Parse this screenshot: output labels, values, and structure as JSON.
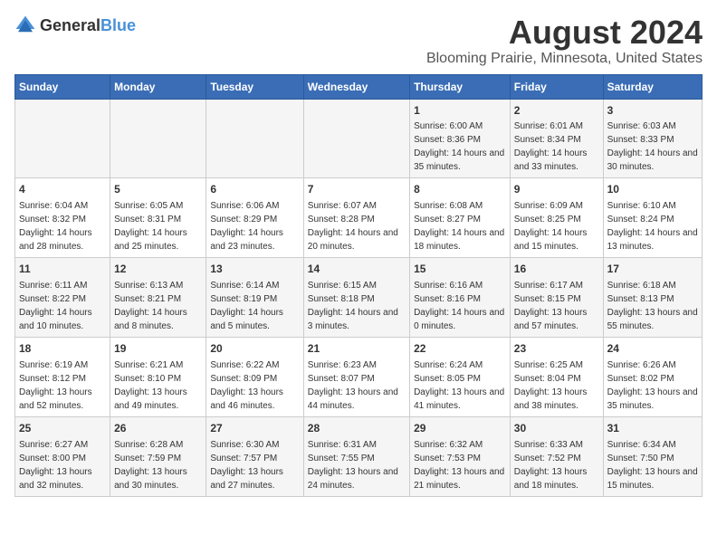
{
  "header": {
    "logo_general": "General",
    "logo_blue": "Blue",
    "main_title": "August 2024",
    "subtitle": "Blooming Prairie, Minnesota, United States"
  },
  "days_of_week": [
    "Sunday",
    "Monday",
    "Tuesday",
    "Wednesday",
    "Thursday",
    "Friday",
    "Saturday"
  ],
  "weeks": [
    {
      "cells": [
        {
          "day": "",
          "sunrise": "",
          "sunset": "",
          "daylight": ""
        },
        {
          "day": "",
          "sunrise": "",
          "sunset": "",
          "daylight": ""
        },
        {
          "day": "",
          "sunrise": "",
          "sunset": "",
          "daylight": ""
        },
        {
          "day": "",
          "sunrise": "",
          "sunset": "",
          "daylight": ""
        },
        {
          "day": "1",
          "sunrise": "Sunrise: 6:00 AM",
          "sunset": "Sunset: 8:36 PM",
          "daylight": "Daylight: 14 hours and 35 minutes."
        },
        {
          "day": "2",
          "sunrise": "Sunrise: 6:01 AM",
          "sunset": "Sunset: 8:34 PM",
          "daylight": "Daylight: 14 hours and 33 minutes."
        },
        {
          "day": "3",
          "sunrise": "Sunrise: 6:03 AM",
          "sunset": "Sunset: 8:33 PM",
          "daylight": "Daylight: 14 hours and 30 minutes."
        }
      ]
    },
    {
      "cells": [
        {
          "day": "4",
          "sunrise": "Sunrise: 6:04 AM",
          "sunset": "Sunset: 8:32 PM",
          "daylight": "Daylight: 14 hours and 28 minutes."
        },
        {
          "day": "5",
          "sunrise": "Sunrise: 6:05 AM",
          "sunset": "Sunset: 8:31 PM",
          "daylight": "Daylight: 14 hours and 25 minutes."
        },
        {
          "day": "6",
          "sunrise": "Sunrise: 6:06 AM",
          "sunset": "Sunset: 8:29 PM",
          "daylight": "Daylight: 14 hours and 23 minutes."
        },
        {
          "day": "7",
          "sunrise": "Sunrise: 6:07 AM",
          "sunset": "Sunset: 8:28 PM",
          "daylight": "Daylight: 14 hours and 20 minutes."
        },
        {
          "day": "8",
          "sunrise": "Sunrise: 6:08 AM",
          "sunset": "Sunset: 8:27 PM",
          "daylight": "Daylight: 14 hours and 18 minutes."
        },
        {
          "day": "9",
          "sunrise": "Sunrise: 6:09 AM",
          "sunset": "Sunset: 8:25 PM",
          "daylight": "Daylight: 14 hours and 15 minutes."
        },
        {
          "day": "10",
          "sunrise": "Sunrise: 6:10 AM",
          "sunset": "Sunset: 8:24 PM",
          "daylight": "Daylight: 14 hours and 13 minutes."
        }
      ]
    },
    {
      "cells": [
        {
          "day": "11",
          "sunrise": "Sunrise: 6:11 AM",
          "sunset": "Sunset: 8:22 PM",
          "daylight": "Daylight: 14 hours and 10 minutes."
        },
        {
          "day": "12",
          "sunrise": "Sunrise: 6:13 AM",
          "sunset": "Sunset: 8:21 PM",
          "daylight": "Daylight: 14 hours and 8 minutes."
        },
        {
          "day": "13",
          "sunrise": "Sunrise: 6:14 AM",
          "sunset": "Sunset: 8:19 PM",
          "daylight": "Daylight: 14 hours and 5 minutes."
        },
        {
          "day": "14",
          "sunrise": "Sunrise: 6:15 AM",
          "sunset": "Sunset: 8:18 PM",
          "daylight": "Daylight: 14 hours and 3 minutes."
        },
        {
          "day": "15",
          "sunrise": "Sunrise: 6:16 AM",
          "sunset": "Sunset: 8:16 PM",
          "daylight": "Daylight: 14 hours and 0 minutes."
        },
        {
          "day": "16",
          "sunrise": "Sunrise: 6:17 AM",
          "sunset": "Sunset: 8:15 PM",
          "daylight": "Daylight: 13 hours and 57 minutes."
        },
        {
          "day": "17",
          "sunrise": "Sunrise: 6:18 AM",
          "sunset": "Sunset: 8:13 PM",
          "daylight": "Daylight: 13 hours and 55 minutes."
        }
      ]
    },
    {
      "cells": [
        {
          "day": "18",
          "sunrise": "Sunrise: 6:19 AM",
          "sunset": "Sunset: 8:12 PM",
          "daylight": "Daylight: 13 hours and 52 minutes."
        },
        {
          "day": "19",
          "sunrise": "Sunrise: 6:21 AM",
          "sunset": "Sunset: 8:10 PM",
          "daylight": "Daylight: 13 hours and 49 minutes."
        },
        {
          "day": "20",
          "sunrise": "Sunrise: 6:22 AM",
          "sunset": "Sunset: 8:09 PM",
          "daylight": "Daylight: 13 hours and 46 minutes."
        },
        {
          "day": "21",
          "sunrise": "Sunrise: 6:23 AM",
          "sunset": "Sunset: 8:07 PM",
          "daylight": "Daylight: 13 hours and 44 minutes."
        },
        {
          "day": "22",
          "sunrise": "Sunrise: 6:24 AM",
          "sunset": "Sunset: 8:05 PM",
          "daylight": "Daylight: 13 hours and 41 minutes."
        },
        {
          "day": "23",
          "sunrise": "Sunrise: 6:25 AM",
          "sunset": "Sunset: 8:04 PM",
          "daylight": "Daylight: 13 hours and 38 minutes."
        },
        {
          "day": "24",
          "sunrise": "Sunrise: 6:26 AM",
          "sunset": "Sunset: 8:02 PM",
          "daylight": "Daylight: 13 hours and 35 minutes."
        }
      ]
    },
    {
      "cells": [
        {
          "day": "25",
          "sunrise": "Sunrise: 6:27 AM",
          "sunset": "Sunset: 8:00 PM",
          "daylight": "Daylight: 13 hours and 32 minutes."
        },
        {
          "day": "26",
          "sunrise": "Sunrise: 6:28 AM",
          "sunset": "Sunset: 7:59 PM",
          "daylight": "Daylight: 13 hours and 30 minutes."
        },
        {
          "day": "27",
          "sunrise": "Sunrise: 6:30 AM",
          "sunset": "Sunset: 7:57 PM",
          "daylight": "Daylight: 13 hours and 27 minutes."
        },
        {
          "day": "28",
          "sunrise": "Sunrise: 6:31 AM",
          "sunset": "Sunset: 7:55 PM",
          "daylight": "Daylight: 13 hours and 24 minutes."
        },
        {
          "day": "29",
          "sunrise": "Sunrise: 6:32 AM",
          "sunset": "Sunset: 7:53 PM",
          "daylight": "Daylight: 13 hours and 21 minutes."
        },
        {
          "day": "30",
          "sunrise": "Sunrise: 6:33 AM",
          "sunset": "Sunset: 7:52 PM",
          "daylight": "Daylight: 13 hours and 18 minutes."
        },
        {
          "day": "31",
          "sunrise": "Sunrise: 6:34 AM",
          "sunset": "Sunset: 7:50 PM",
          "daylight": "Daylight: 13 hours and 15 minutes."
        }
      ]
    }
  ]
}
